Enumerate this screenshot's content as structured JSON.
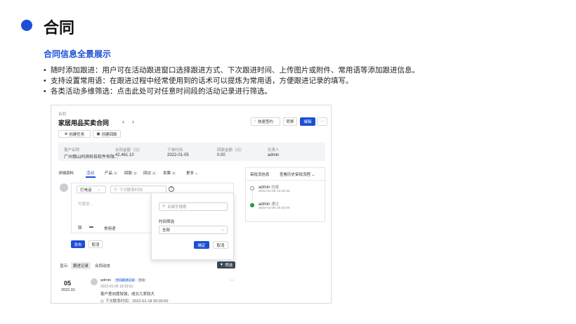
{
  "slide": {
    "title": "合同",
    "subtitle": "合同信息全景展示",
    "bullets": [
      "随时添加跟进：用户可在活动跟进窗口选择跟进方式、下次跟进时间、上传图片或附件、常用语等添加跟进信息。",
      "支持设置常用语：在跟进过程中经常使用到的话术可以提炼为常用语，方便跟进记录的填写。",
      "各类活动多维筛选：点击此处可对任意时间段的活动记录进行筛选。"
    ],
    "bullet_char": "•"
  },
  "app": {
    "breadcrumb": "合同",
    "title": "家居用品买卖合同",
    "nav_prev": "‹",
    "nav_next": "›",
    "actions": {
      "quick_sign": "快速签约",
      "transfer": "转移",
      "edit": "编辑",
      "more": "···"
    },
    "quick_buttons": {
      "create_task": "创建任务",
      "create_payment": "创建回款"
    },
    "info": {
      "customer_label": "客户名称",
      "customer_value": "广州佛山同滨科技软件有限...",
      "amount_label": "合同金额（元）",
      "amount_value": "42,461.10",
      "date_label": "下单时间",
      "date_value": "2022-01-05",
      "paid_label": "回款金额（元）",
      "paid_value": "0.00",
      "owner_label": "负责人",
      "owner_value": "admin"
    },
    "tabs": {
      "details": "详细资料",
      "activity": "活动",
      "products": "产品",
      "products_count": "3",
      "payments": "回款",
      "payments_count": "0",
      "returns": "回访",
      "returns_count": "0",
      "invoices": "发票",
      "invoices_count": "0",
      "more": "更多"
    },
    "composer": {
      "method": "打电话",
      "next_time_placeholder": "下次联系时间",
      "content_placeholder": "写跟进...",
      "phrases": "常用语",
      "publish": "发布",
      "cancel": "取消"
    },
    "filter_popup": {
      "search_placeholder": "关键字搜索",
      "time_label": "时间筛选",
      "time_value": "全部",
      "confirm": "确定",
      "cancel": "取消"
    },
    "display": {
      "label": "显示:",
      "follow_records": "跟进记录",
      "contract_activity": "合同动态",
      "filter_button": "筛选"
    },
    "record": {
      "day": "05",
      "month": "2022.01",
      "user": "admin",
      "tag1": "合同跟进记录",
      "tag2": "活动",
      "time": "2022-01-05 18:29:51",
      "content": "客户意向度较强，成交几率较大",
      "next": "下次联系时间：2022-01-18 00:00:00",
      "more": "···"
    },
    "approval": {
      "title": "审批流信息",
      "history": "查看历史审批流程",
      "steps": [
        {
          "user": "admin",
          "action": "创建",
          "time": "2022-01-05 13:40:34"
        },
        {
          "user": "admin",
          "action": "通过",
          "time": "2022-01-05 16:42:00"
        }
      ]
    },
    "colors": {
      "primary": "#1c4fd6",
      "success": "#1a9b4b"
    }
  }
}
